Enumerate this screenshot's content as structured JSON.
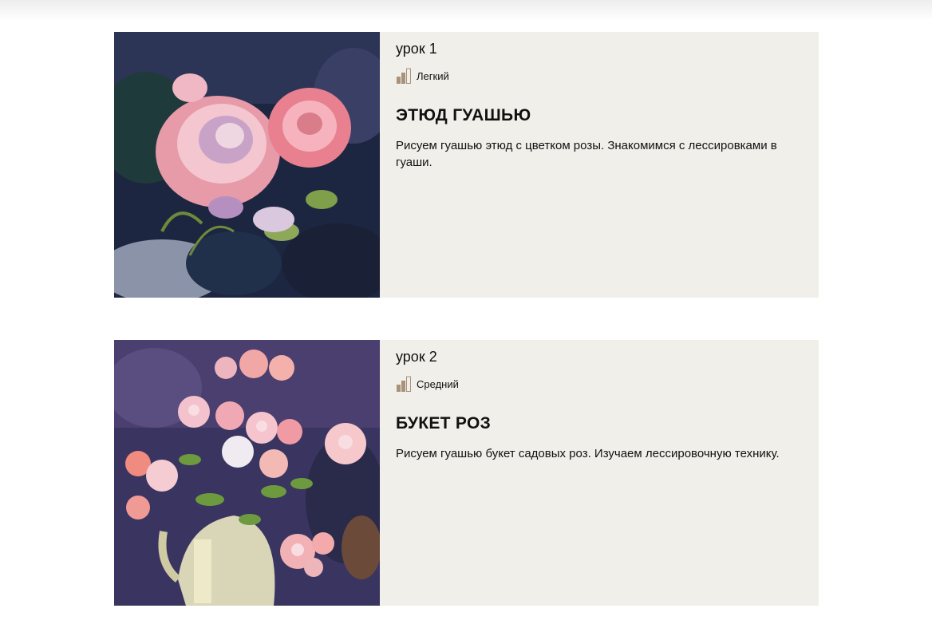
{
  "lessons": [
    {
      "number_label": "урок 1",
      "level_label": "Легкий",
      "level_icon": "difficulty-bars-icon",
      "title": "ЭТЮД ГУАШЬЮ",
      "description": "Рисуем гуашью этюд с цветком розы. Знакомимся с лессировками в гуаши."
    },
    {
      "number_label": "урок 2",
      "level_label": "Средний",
      "level_icon": "difficulty-bars-icon",
      "title": "БУКЕТ РОЗ",
      "description": "Рисуем гуашью букет садовых роз. Изучаем лессировочную технику."
    }
  ],
  "colors": {
    "card_background": "#f0efe9",
    "level_icon_active": "#a8927a",
    "level_icon_outline": "#a8927a"
  }
}
